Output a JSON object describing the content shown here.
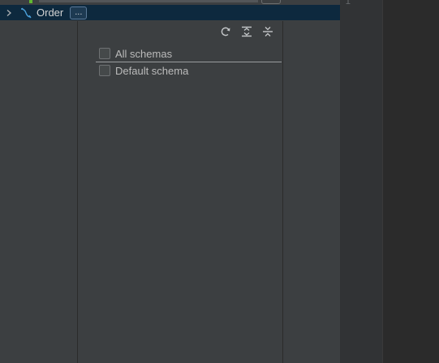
{
  "tree": {
    "node_label": "Order",
    "more_label": "..."
  },
  "schema_popup": {
    "items": [
      {
        "label": "All schemas",
        "checked": false
      },
      {
        "label": "Default schema",
        "checked": false
      }
    ],
    "toolbar_icons": [
      "refresh-icon",
      "expand-all-icon",
      "collapse-all-icon"
    ]
  },
  "editor": {
    "line_number": "1"
  }
}
